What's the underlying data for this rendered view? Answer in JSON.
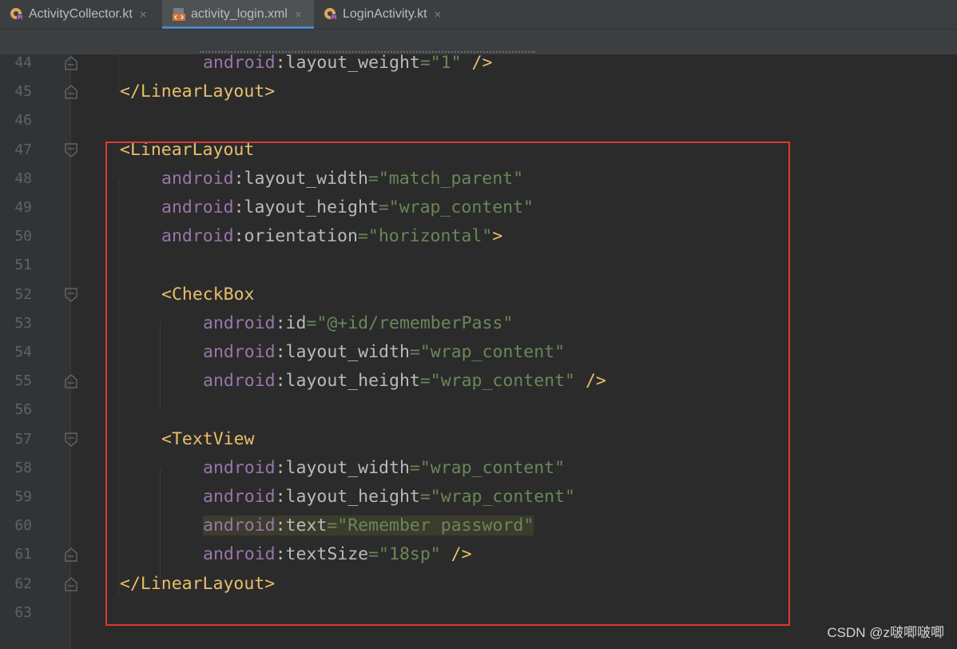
{
  "tabs": [
    {
      "label": "ActivityCollector.kt",
      "icon": "kotlin-file-icon",
      "active": false
    },
    {
      "label": "activity_login.xml",
      "icon": "xml-layout-file-icon",
      "active": true
    },
    {
      "label": "LoginActivity.kt",
      "icon": "kotlin-file-icon",
      "active": false
    }
  ],
  "tab_close_glyph": "×",
  "editor": {
    "lines": [
      {
        "n": "44",
        "indent": 2,
        "parts": [
          [
            "ns",
            "android"
          ],
          [
            "attr",
            ":layout_weight"
          ],
          [
            "val",
            "=\"1\""
          ],
          [
            "tag",
            " />"
          ]
        ]
      },
      {
        "n": "45",
        "indent": 0,
        "parts": [
          [
            "tag",
            "</LinearLayout>"
          ]
        ]
      },
      {
        "n": "46",
        "indent": 0,
        "parts": []
      },
      {
        "n": "47",
        "indent": 0,
        "parts": [
          [
            "tag",
            "<LinearLayout"
          ]
        ]
      },
      {
        "n": "48",
        "indent": 1,
        "parts": [
          [
            "ns",
            "android"
          ],
          [
            "attr",
            ":layout_width"
          ],
          [
            "val",
            "=\"match_parent\""
          ]
        ]
      },
      {
        "n": "49",
        "indent": 1,
        "parts": [
          [
            "ns",
            "android"
          ],
          [
            "attr",
            ":layout_height"
          ],
          [
            "val",
            "=\"wrap_content\""
          ]
        ]
      },
      {
        "n": "50",
        "indent": 1,
        "parts": [
          [
            "ns",
            "android"
          ],
          [
            "attr",
            ":orientation"
          ],
          [
            "val",
            "=\"horizontal\""
          ],
          [
            "tag",
            ">"
          ]
        ]
      },
      {
        "n": "51",
        "indent": 0,
        "parts": []
      },
      {
        "n": "52",
        "indent": 1,
        "parts": [
          [
            "tag",
            "<CheckBox"
          ]
        ]
      },
      {
        "n": "53",
        "indent": 2,
        "parts": [
          [
            "ns",
            "android"
          ],
          [
            "attr",
            ":id"
          ],
          [
            "val",
            "=\"@+id/rememberPass\""
          ]
        ]
      },
      {
        "n": "54",
        "indent": 2,
        "parts": [
          [
            "ns",
            "android"
          ],
          [
            "attr",
            ":layout_width"
          ],
          [
            "val",
            "=\"wrap_content\""
          ]
        ]
      },
      {
        "n": "55",
        "indent": 2,
        "parts": [
          [
            "ns",
            "android"
          ],
          [
            "attr",
            ":layout_height"
          ],
          [
            "val",
            "=\"wrap_content\""
          ],
          [
            "tag",
            " />"
          ]
        ]
      },
      {
        "n": "56",
        "indent": 0,
        "parts": []
      },
      {
        "n": "57",
        "indent": 1,
        "parts": [
          [
            "tag",
            "<TextView"
          ]
        ]
      },
      {
        "n": "58",
        "indent": 2,
        "parts": [
          [
            "ns",
            "android"
          ],
          [
            "attr",
            ":layout_width"
          ],
          [
            "val",
            "=\"wrap_content\""
          ]
        ]
      },
      {
        "n": "59",
        "indent": 2,
        "parts": [
          [
            "ns",
            "android"
          ],
          [
            "attr",
            ":layout_height"
          ],
          [
            "val",
            "=\"wrap_content\""
          ]
        ]
      },
      {
        "n": "60",
        "indent": 2,
        "highlight": true,
        "parts": [
          [
            "ns",
            "android"
          ],
          [
            "attr",
            ":text"
          ],
          [
            "val",
            "=\"Remember password\""
          ]
        ]
      },
      {
        "n": "61",
        "indent": 2,
        "parts": [
          [
            "ns",
            "android"
          ],
          [
            "attr",
            ":textSize"
          ],
          [
            "val",
            "=\"18sp\""
          ],
          [
            "tag",
            " />"
          ]
        ]
      },
      {
        "n": "62",
        "indent": 0,
        "parts": [
          [
            "tag",
            "</LinearLayout>"
          ]
        ]
      },
      {
        "n": "63",
        "indent": 0,
        "parts": []
      }
    ],
    "fold_markers": {
      "44": "end",
      "45": "end",
      "47": "start",
      "52": "start",
      "55": "end",
      "57": "start",
      "61": "end",
      "62": "end"
    }
  },
  "watermark": "CSDN @z啵唧啵唧",
  "colors": {
    "accent": "#4a88c7",
    "annotation_box": "#e23535"
  }
}
